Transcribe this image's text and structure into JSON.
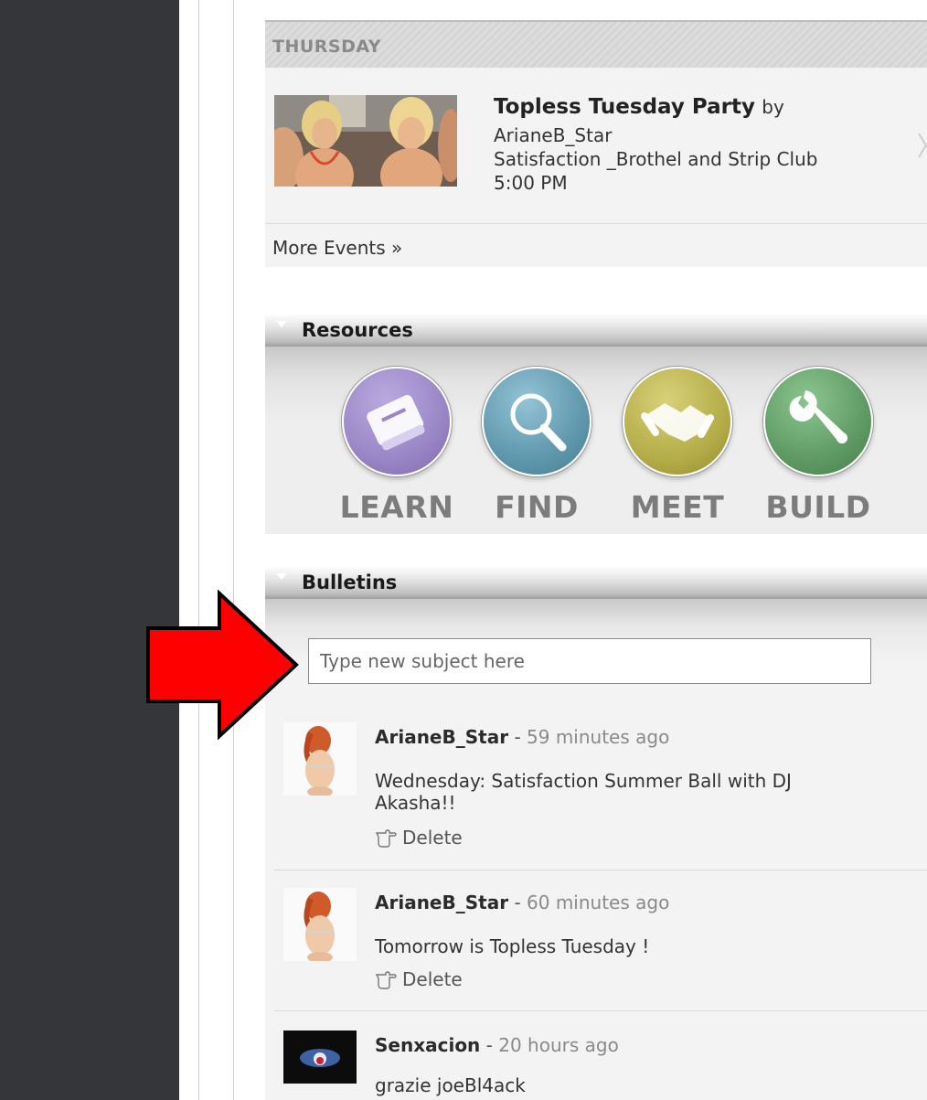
{
  "events": {
    "day": "THURSDAY",
    "event": {
      "title": "Topless Tuesday Party",
      "by_word": "by",
      "host": "ArianeB_Star",
      "venue": "Satisfaction _Brothel and Strip Club",
      "time": "5:00 PM"
    },
    "more_events": "More Events »"
  },
  "resources": {
    "title": "Resources",
    "items": [
      {
        "label": "LEARN",
        "icon": "book-icon",
        "color": "#9a86c6"
      },
      {
        "label": "FIND",
        "icon": "magnifier-icon",
        "color": "#5f97ad"
      },
      {
        "label": "MEET",
        "icon": "handshake-icon",
        "color": "#b5ad48"
      },
      {
        "label": "BUILD",
        "icon": "wrench-icon",
        "color": "#5f9a64"
      }
    ]
  },
  "bulletins": {
    "title": "Bulletins",
    "input_placeholder": "Type new subject here",
    "separator": "-",
    "delete_label": "Delete",
    "items": [
      {
        "author": "ArianeB_Star",
        "time": "59 minutes ago",
        "text": "Wednesday: Satisfaction Summer Ball with DJ Akasha!!"
      },
      {
        "author": "ArianeB_Star",
        "time": "60 minutes ago",
        "text": "Tomorrow is Topless Tuesday !"
      },
      {
        "author": "Senxacion",
        "time": "20 hours ago",
        "text": "grazie joeBl4ack"
      }
    ]
  },
  "colors": {
    "sidebar": "#35363a",
    "arrow": "#ff0000"
  }
}
